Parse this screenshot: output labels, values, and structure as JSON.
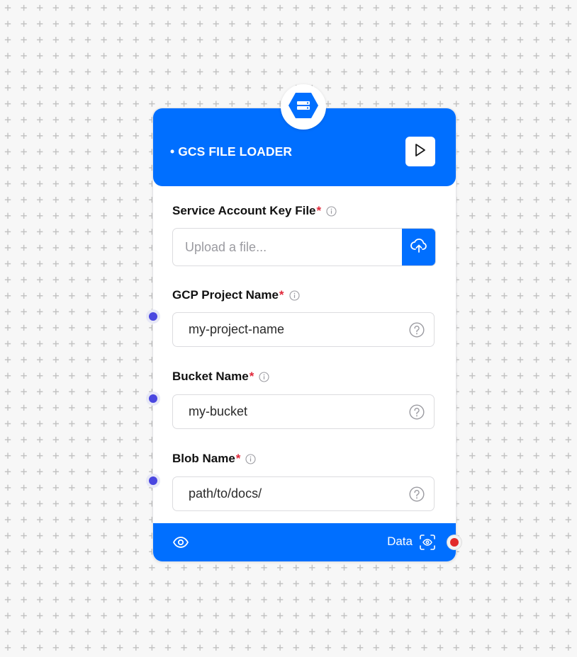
{
  "node": {
    "title": "• GCS FILE LOADER",
    "icon": "gcs-storage-icon",
    "accent_color": "#006fff"
  },
  "fields": {
    "service_account": {
      "label": "Service Account Key File",
      "required_mark": "*",
      "placeholder": "Upload a file..."
    },
    "project": {
      "label": "GCP Project Name",
      "required_mark": "*",
      "value": "my-project-name"
    },
    "bucket": {
      "label": "Bucket Name",
      "required_mark": "*",
      "value": "my-bucket"
    },
    "blob": {
      "label": "Blob Name",
      "required_mark": "*",
      "value": "path/to/docs/"
    }
  },
  "footer": {
    "output_label": "Data"
  },
  "handle_colors": {
    "input": "#4a47e0",
    "output": "#e22a2a"
  }
}
